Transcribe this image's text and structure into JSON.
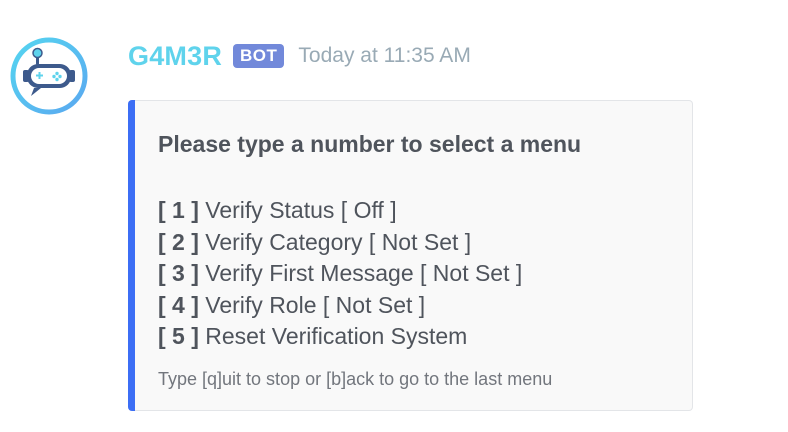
{
  "author": {
    "name": "G4M3R",
    "name_color": "#5fd3ec",
    "bot_tag": "BOT",
    "bot_tag_color": "#7289da",
    "timestamp": "Today at 11:35 AM",
    "avatar_icon": "robot-gamepad-icon"
  },
  "embed": {
    "accent_color": "#3c6ef5",
    "title": "Please type a number to select a menu",
    "options": [
      {
        "number": "[ 1 ]",
        "label": "Verify Status [ Off ]"
      },
      {
        "number": "[ 2 ]",
        "label": "Verify Category [ Not Set ]"
      },
      {
        "number": "[ 3 ]",
        "label": "Verify First Message [ Not Set ]"
      },
      {
        "number": "[ 4 ]",
        "label": "Verify Role [ Not Set ]"
      },
      {
        "number": "[ 5 ]",
        "label": "Reset Verification System"
      }
    ],
    "footer": "Type [q]uit to stop or [b]ack to go to the last menu"
  }
}
